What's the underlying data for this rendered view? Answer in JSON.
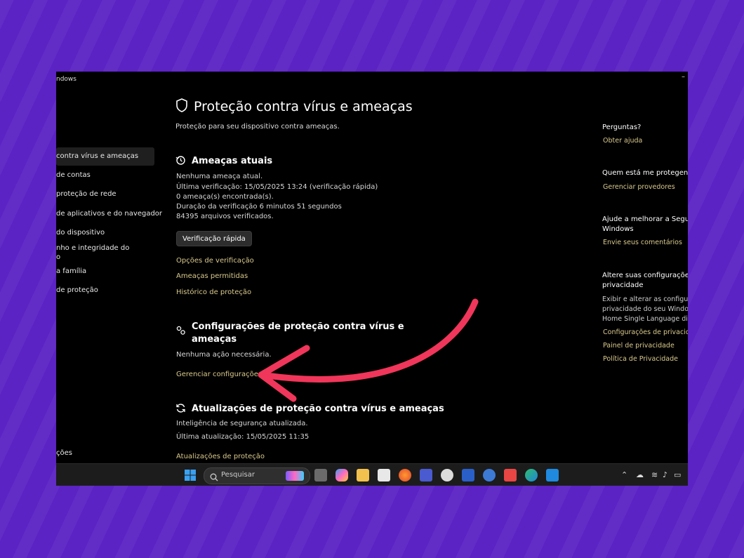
{
  "window": {
    "title": "ndows"
  },
  "nav": {
    "items": [
      "contra vírus e ameaças",
      "de contas",
      "proteção de rede",
      "de aplicativos e do navegador",
      "do dispositivo",
      "nho e integridade do",
      "o",
      "a família",
      "de proteção",
      "ções"
    ]
  },
  "main": {
    "title": "Proteção contra vírus e ameaças",
    "subtitle": "Proteção para seu dispositivo contra ameaças.",
    "threats": {
      "title": "Ameaças atuais",
      "lines": [
        "Nenhuma ameaça atual.",
        "Última verificação: 15/05/2025 13:24 (verificação rápida)",
        "0 ameaça(s) encontrada(s).",
        "Duração da verificação 6 minutos 51 segundos",
        "84395 arquivos verificados."
      ],
      "button": "Verificação rápida",
      "links": [
        "Opções de verificação",
        "Ameaças permitidas",
        "Histórico de proteção"
      ]
    },
    "settings": {
      "title_line1": "Configurações de proteção contra vírus e",
      "title_line2": "ameaças",
      "status": "Nenhuma ação necessária.",
      "link": "Gerenciar configurações"
    },
    "updates": {
      "title": "Atualizações de proteção contra vírus e ameaças",
      "line1": "Inteligência de segurança atualizada.",
      "line2": "Última atualização: 15/05/2025 11:35",
      "link": "Atualizações de proteção"
    }
  },
  "right": {
    "questions": {
      "title": "Perguntas?",
      "link": "Obter ajuda"
    },
    "protecting": {
      "title": "Quem está me protegendo",
      "link": "Gerenciar provedores"
    },
    "improve": {
      "title_line1": "Ajude a melhorar a Segurar",
      "title_line2": "Windows",
      "link": "Envie seus comentários"
    },
    "privacy": {
      "title_line1": "Altere suas configurações c",
      "title_line2": "privacidade",
      "text_line1": "Exibir e alterar as configura",
      "text_line2": "privacidade do seu Window",
      "text_line3": "Home Single Language disp",
      "links": [
        "Configurações de privacidade",
        "Painel de privacidade",
        "Política de Privacidade"
      ]
    }
  },
  "taskbar": {
    "search_placeholder": "Pesquisar",
    "icons": [
      "task-view-icon",
      "copilot-icon",
      "file-explorer-icon",
      "store-icon",
      "firefox-icon",
      "app-icon",
      "music-icon",
      "word-icon",
      "edge-dev-icon",
      "app-red-icon",
      "edge-icon",
      "defender-icon"
    ]
  },
  "colors": {
    "accent_link": "#d9c98c",
    "background": "#5b22c4",
    "arrow": "#f0365a"
  }
}
